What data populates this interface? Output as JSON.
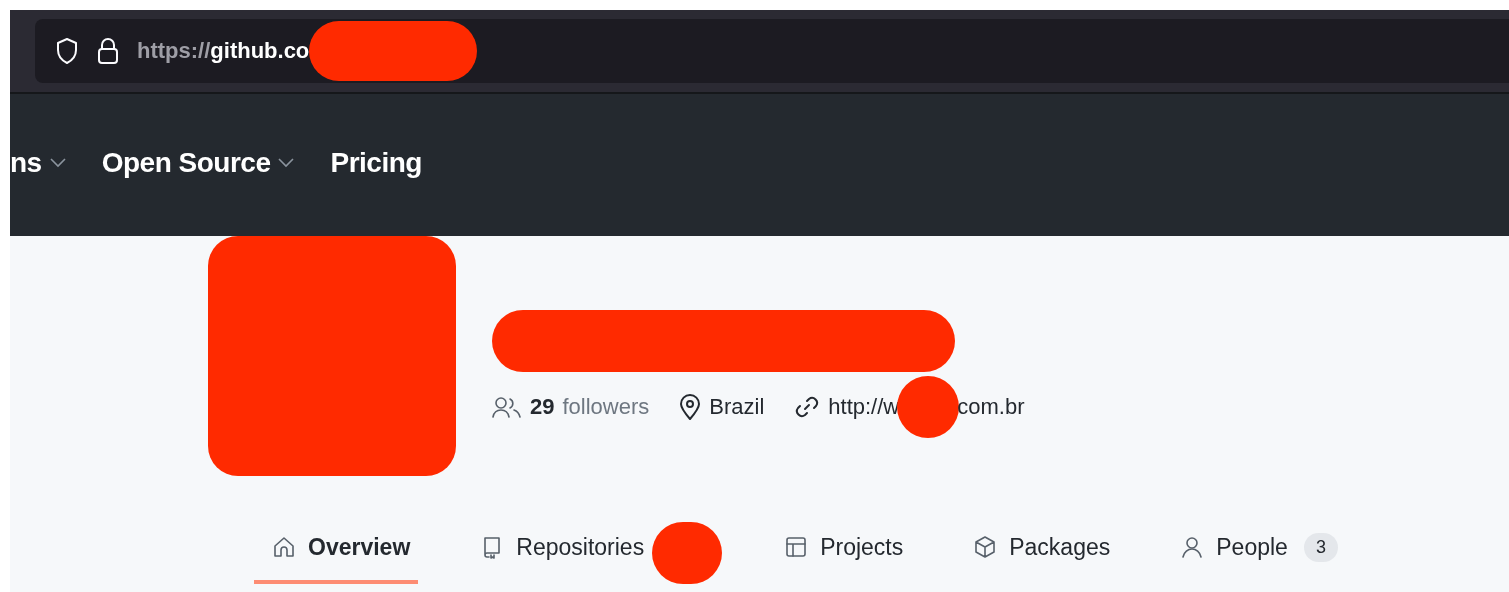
{
  "address_bar": {
    "url_scheme": "https://",
    "url_host": "github.co"
  },
  "nav": {
    "items": [
      {
        "label": "ns",
        "dropdown": true
      },
      {
        "label": "Open Source",
        "dropdown": true
      },
      {
        "label": "Pricing",
        "dropdown": false
      }
    ]
  },
  "profile": {
    "followers_count": "29",
    "followers_label": "followers",
    "location": "Brazil",
    "website_start": "http://w",
    "website_end": "com.br"
  },
  "tabs": [
    {
      "kind": "home",
      "label": "Overview",
      "selected": true
    },
    {
      "kind": "repo",
      "label": "Repositories",
      "selected": false
    },
    {
      "kind": "table",
      "label": "Projects",
      "selected": false
    },
    {
      "kind": "package",
      "label": "Packages",
      "selected": false
    },
    {
      "kind": "person",
      "label": "People",
      "selected": false,
      "count": "3"
    }
  ]
}
